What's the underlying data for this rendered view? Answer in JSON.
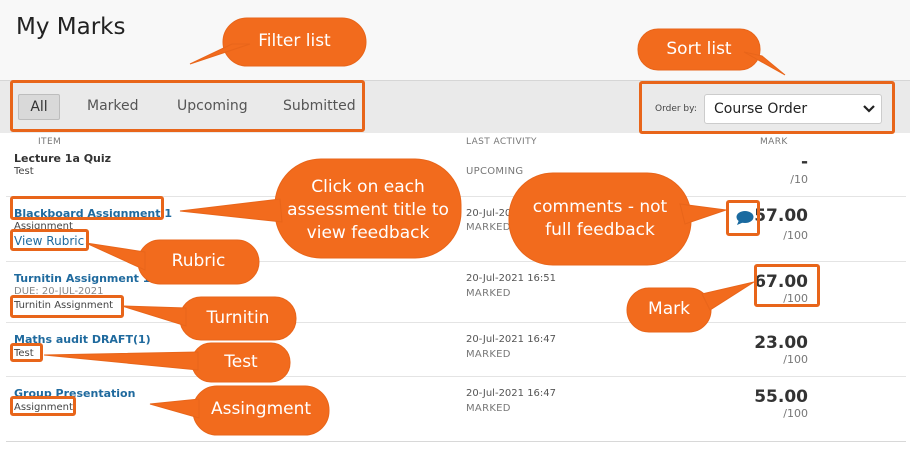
{
  "page": {
    "title": "My Marks"
  },
  "filters": [
    "All",
    "Marked",
    "Upcoming",
    "Submitted"
  ],
  "sort": {
    "label": "Order by:",
    "value": "Course Order"
  },
  "columns": {
    "item": "ITEM",
    "activity": "LAST ACTIVITY",
    "mark": "MARK"
  },
  "rows": [
    {
      "title": "Lecture 1a Quiz",
      "sub": "Test",
      "date": "",
      "status": "UPCOMING",
      "mark": "-",
      "out_of": "/10"
    },
    {
      "title": "Blackboard Assignment 1",
      "sub": "Assignment",
      "link": "View Rubric",
      "date": "20-Jul-20",
      "status": "MARKED",
      "mark": "57.00",
      "out_of": "/100"
    },
    {
      "title": "Turnitin Assignment 1",
      "due": "DUE: 20-JUL-2021",
      "sub": "Turnitin Assignment",
      "date": "20-Jul-2021 16:51",
      "status": "MARKED",
      "mark": "67.00",
      "out_of": "/100"
    },
    {
      "title": "Maths audit DRAFT(1)",
      "sub": "Test",
      "date": "20-Jul-2021 16:47",
      "status": "MARKED",
      "mark": "23.00",
      "out_of": "/100"
    },
    {
      "title": "Group Presentation",
      "sub": "Assignment",
      "date": "20-Jul-2021 16:47",
      "status": "MARKED",
      "mark": "55.00",
      "out_of": "/100"
    }
  ],
  "callouts": {
    "filter": "Filter list",
    "sort": "Sort list",
    "click": [
      "Click on each",
      "assessment title to",
      "view feedback"
    ],
    "comments": [
      "comments - not",
      "full feedback"
    ],
    "rubric": "Rubric",
    "mark": "Mark",
    "turnitin": "Turnitin",
    "test": "Test",
    "assignment": "Assingment"
  },
  "icons": {
    "comment": "comment-bubble-icon",
    "dropdown": "chevron-down-icon"
  },
  "colors": {
    "callout": "#f26b1d",
    "callout_border": "#e8651a",
    "link": "#1f6a9e",
    "comment_icon": "#1a6aa0"
  }
}
